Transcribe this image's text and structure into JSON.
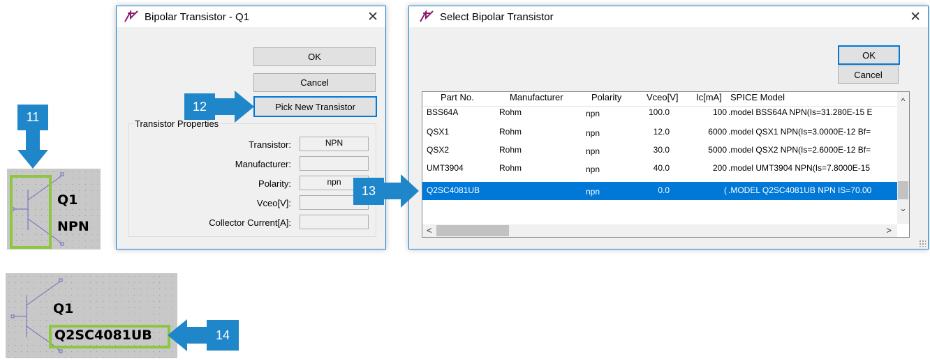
{
  "callouts": [
    "11",
    "12",
    "13",
    "14"
  ],
  "schematic_top": {
    "ref": "Q1",
    "value": "NPN"
  },
  "schematic_bottom": {
    "ref": "Q1",
    "value": "Q2SC4081UB"
  },
  "dialog1": {
    "title": "Bipolar Transistor - Q1",
    "ok": "OK",
    "cancel": "Cancel",
    "pick": "Pick New Transistor",
    "group_label": "Transistor Properties",
    "props": [
      {
        "label": "Transistor:",
        "value": "NPN"
      },
      {
        "label": "Manufacturer:",
        "value": ""
      },
      {
        "label": "Polarity:",
        "value": "npn"
      },
      {
        "label": "Vceo[V]:",
        "value": ""
      },
      {
        "label": "Collector Current[A]:",
        "value": ""
      }
    ]
  },
  "dialog2": {
    "title": "Select Bipolar Transistor",
    "ok": "OK",
    "cancel": "Cancel",
    "columns": [
      "Part No.",
      "Manufacturer",
      "Polarity",
      "Vceo[V]",
      "Ic[mA]",
      "SPICE Model"
    ],
    "rows": [
      {
        "part": "BSS64A",
        "mfr": "Rohm",
        "pol": "npn",
        "vceo": "100.0",
        "ic": "100",
        "model": ".model BSS64A NPN(Is=31.280E-15 E"
      },
      {
        "part": "QSX1",
        "mfr": "Rohm",
        "pol": "npn",
        "vceo": "12.0",
        "ic": "6000",
        "model": ".model QSX1 NPN(Is=3.0000E-12 Bf="
      },
      {
        "part": "QSX2",
        "mfr": "Rohm",
        "pol": "npn",
        "vceo": "30.0",
        "ic": "5000",
        "model": ".model QSX2 NPN(Is=2.6000E-12 Bf="
      },
      {
        "part": "UMT3904",
        "mfr": "Rohm",
        "pol": "npn",
        "vceo": "40.0",
        "ic": "200",
        "model": ".model UMT3904 NPN(Is=7.8000E-15"
      },
      {
        "part": "Q2SC4081UB",
        "mfr": "",
        "pol": "npn",
        "vceo": "0.0",
        "ic": "(",
        "model": ".MODEL Q2SC4081UB NPN IS=70.00"
      }
    ],
    "selected_index": 4
  },
  "colors": {
    "accent": "#1f87c9",
    "highlight": "#8dc63f",
    "selection": "#0078d7"
  }
}
